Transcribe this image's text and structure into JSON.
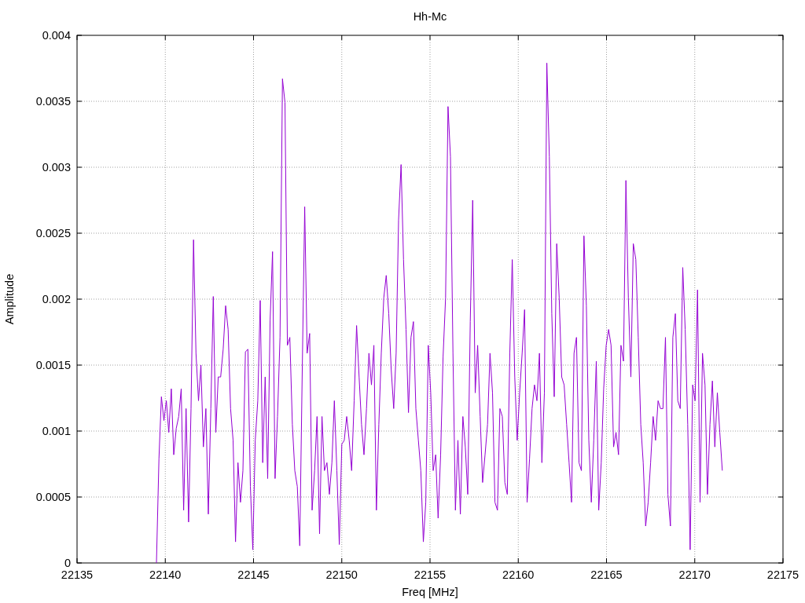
{
  "chart_data": {
    "type": "line",
    "grid": true,
    "title": "Hh-Mc",
    "xlabel": "Freq [MHz]",
    "ylabel": "Amplitude",
    "xlim": [
      22135,
      22175
    ],
    "ylim": [
      0,
      0.004
    ],
    "xticks": [
      22135,
      22140,
      22145,
      22150,
      22155,
      22160,
      22165,
      22170,
      22175
    ],
    "yticks": [
      0,
      0.0005,
      0.001,
      0.0015,
      0.002,
      0.0025,
      0.003,
      0.0035,
      0.004
    ],
    "x": [
      22139.5,
      22139.64,
      22139.78,
      22139.92,
      22140.06,
      22140.2,
      22140.34,
      22140.48,
      22140.62,
      22140.76,
      22140.9,
      22141.04,
      22141.18,
      22141.32,
      22141.46,
      22141.6,
      22141.74,
      22141.88,
      22142.02,
      22142.16,
      22142.3,
      22142.44,
      22142.58,
      22142.72,
      22142.86,
      22143,
      22143.14,
      22143.28,
      22143.42,
      22143.56,
      22143.7,
      22143.84,
      22143.98,
      22144.12,
      22144.26,
      22144.4,
      22144.54,
      22144.68,
      22144.82,
      22144.96,
      22145.1,
      22145.24,
      22145.38,
      22145.52,
      22145.66,
      22145.8,
      22145.94,
      22146.08,
      22146.22,
      22146.36,
      22146.5,
      22146.64,
      22146.78,
      22146.92,
      22147.06,
      22147.2,
      22147.34,
      22147.48,
      22147.62,
      22147.76,
      22147.9,
      22148.04,
      22148.18,
      22148.32,
      22148.46,
      22148.6,
      22148.74,
      22148.88,
      22149.02,
      22149.16,
      22149.3,
      22149.44,
      22149.58,
      22149.72,
      22149.86,
      22150,
      22150.14,
      22150.28,
      22150.42,
      22150.56,
      22150.7,
      22150.84,
      22150.98,
      22151.12,
      22151.26,
      22151.4,
      22151.54,
      22151.68,
      22151.82,
      22151.96,
      22152.1,
      22152.24,
      22152.38,
      22152.52,
      22152.66,
      22152.8,
      22152.94,
      22153.08,
      22153.22,
      22153.36,
      22153.5,
      22153.64,
      22153.78,
      22153.92,
      22154.06,
      22154.2,
      22154.34,
      22154.48,
      22154.62,
      22154.76,
      22154.9,
      22155.04,
      22155.18,
      22155.32,
      22155.46,
      22155.6,
      22155.74,
      22155.88,
      22156.02,
      22156.16,
      22156.3,
      22156.44,
      22156.58,
      22156.72,
      22156.86,
      22157,
      22157.14,
      22157.28,
      22157.42,
      22157.56,
      22157.7,
      22157.84,
      22157.98,
      22158.12,
      22158.26,
      22158.4,
      22158.54,
      22158.68,
      22158.82,
      22158.96,
      22159.1,
      22159.24,
      22159.38,
      22159.52,
      22159.66,
      22159.8,
      22159.94,
      22160.08,
      22160.22,
      22160.36,
      22160.5,
      22160.64,
      22160.78,
      22160.92,
      22161.06,
      22161.2,
      22161.34,
      22161.48,
      22161.62,
      22161.76,
      22161.9,
      22162.04,
      22162.18,
      22162.32,
      22162.46,
      22162.6,
      22162.74,
      22162.88,
      22163.02,
      22163.16,
      22163.3,
      22163.44,
      22163.58,
      22163.72,
      22163.86,
      22164,
      22164.14,
      22164.28,
      22164.42,
      22164.56,
      22164.7,
      22164.84,
      22164.98,
      22165.12,
      22165.26,
      22165.4,
      22165.54,
      22165.68,
      22165.82,
      22165.96,
      22166.1,
      22166.24,
      22166.38,
      22166.52,
      22166.66,
      22166.8,
      22166.94,
      22167.08,
      22167.22,
      22167.36,
      22167.5,
      22167.64,
      22167.78,
      22167.92,
      22168.06,
      22168.2,
      22168.34,
      22168.48,
      22168.62,
      22168.76,
      22168.9,
      22169.04,
      22169.18,
      22169.32,
      22169.46,
      22169.6,
      22169.74,
      22169.88,
      22170.02,
      22170.16,
      22170.3,
      22170.44,
      22170.58,
      22170.72,
      22170.86,
      22171,
      22171.14,
      22171.28,
      22171.42,
      22171.56
    ],
    "series": [
      {
        "color": "#9400d3",
        "values": [
          0,
          0.00079,
          0.00126,
          0.00108,
          0.00123,
          0.00099,
          0.00132,
          0.00082,
          0.00102,
          0.00111,
          0.00132,
          0.0004,
          0.00117,
          0.00031,
          0.00117,
          0.00245,
          0.00159,
          0.00123,
          0.0015,
          0.00088,
          0.00117,
          0.00037,
          0.00117,
          0.00202,
          0.00099,
          0.00141,
          0.00141,
          0.00162,
          0.00195,
          0.00177,
          0.00117,
          0.00093,
          0.00016,
          0.00076,
          0.00046,
          0.0007,
          0.0016,
          0.00162,
          0.00058,
          0.0001,
          0.00093,
          0.00123,
          0.00199,
          0.00076,
          0.00141,
          0.00064,
          0.00184,
          0.00236,
          0.00064,
          0.00111,
          0.00171,
          0.00367,
          0.00349,
          0.00165,
          0.00171,
          0.00105,
          0.0007,
          0.00058,
          0.00013,
          0.00147,
          0.0027,
          0.00159,
          0.00174,
          0.0004,
          0.0007,
          0.00111,
          0.00022,
          0.00111,
          0.0007,
          0.00076,
          0.00052,
          0.00076,
          0.00123,
          0.0007,
          0.00014,
          0.0009,
          0.00093,
          0.00111,
          0.00093,
          0.0007,
          0.00123,
          0.0018,
          0.00141,
          0.00105,
          0.00082,
          0.00117,
          0.00159,
          0.00135,
          0.00165,
          0.0004,
          0.00105,
          0.00159,
          0.00201,
          0.00218,
          0.00189,
          0.00147,
          0.00117,
          0.00159,
          0.0026,
          0.00302,
          0.0023,
          0.00177,
          0.00114,
          0.00171,
          0.00183,
          0.00117,
          0.00093,
          0.0007,
          0.00016,
          0.00046,
          0.00165,
          0.00129,
          0.0007,
          0.00082,
          0.00034,
          0.00082,
          0.00156,
          0.00201,
          0.00346,
          0.00308,
          0.00159,
          0.0004,
          0.00093,
          0.00037,
          0.00111,
          0.00088,
          0.00052,
          0.00183,
          0.00275,
          0.00129,
          0.00165,
          0.00111,
          0.00061,
          0.00082,
          0.00105,
          0.00159,
          0.00129,
          0.00046,
          0.0004,
          0.00117,
          0.00111,
          0.00061,
          0.00052,
          0.00159,
          0.0023,
          0.00141,
          0.00093,
          0.00129,
          0.00159,
          0.00192,
          0.00046,
          0.00079,
          0.00117,
          0.00135,
          0.00123,
          0.00159,
          0.00076,
          0.00129,
          0.00379,
          0.00308,
          0.00189,
          0.00126,
          0.00242,
          0.00201,
          0.00141,
          0.00135,
          0.00105,
          0.00076,
          0.00046,
          0.00159,
          0.00171,
          0.00076,
          0.0007,
          0.00248,
          0.00195,
          0.00093,
          0.00046,
          0.00093,
          0.00153,
          0.0004,
          0.00076,
          0.00132,
          0.00165,
          0.00177,
          0.00165,
          0.00088,
          0.00099,
          0.00082,
          0.00165,
          0.00153,
          0.0029,
          0.00201,
          0.00141,
          0.00242,
          0.0023,
          0.00171,
          0.00105,
          0.00076,
          0.00028,
          0.00046,
          0.00076,
          0.00111,
          0.00093,
          0.00123,
          0.00117,
          0.00117,
          0.00171,
          0.00052,
          0.00028,
          0.00171,
          0.00189,
          0.00123,
          0.00117,
          0.00224,
          0.00177,
          0.00105,
          0.0001,
          0.00135,
          0.00123,
          0.00207,
          0.00046,
          0.00159,
          0.00135,
          0.00052,
          0.00105,
          0.00138,
          0.00088,
          0.00129,
          0.00099,
          0.0007
        ]
      }
    ]
  }
}
